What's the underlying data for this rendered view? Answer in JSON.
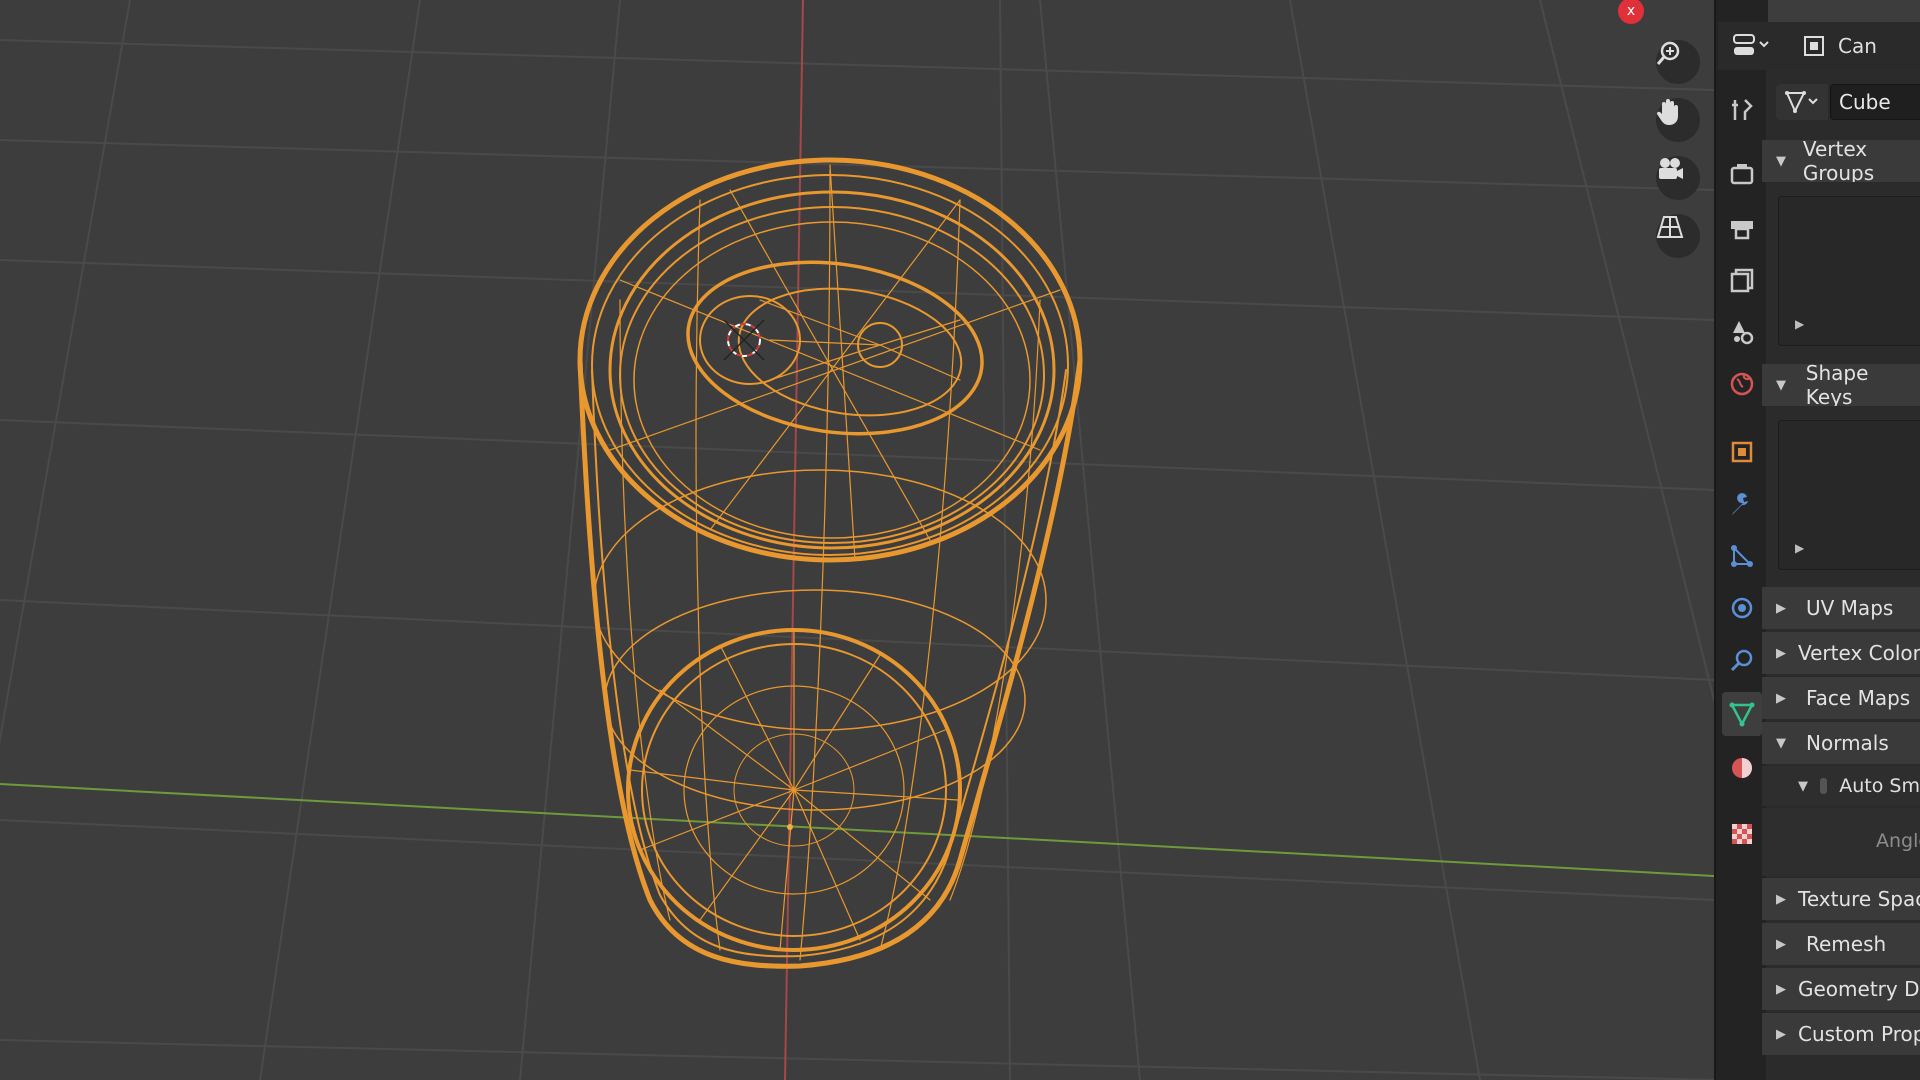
{
  "viewport": {
    "close_label": "x",
    "nav_icons": [
      "zoom-icon",
      "hand-pan-icon",
      "camera-icon",
      "perspective-grid-icon"
    ]
  },
  "properties_header": {
    "editor_icon": "editor-type-icon",
    "object_name": "Can"
  },
  "property_tabs": [
    {
      "name": "tool-icon",
      "color": "#c9c9c9"
    },
    {
      "name": "render-icon",
      "color": "#c9c9c9"
    },
    {
      "name": "output-icon",
      "color": "#c9c9c9"
    },
    {
      "name": "view-layer-icon",
      "color": "#c9c9c9"
    },
    {
      "name": "scene-icon",
      "color": "#c9c9c9"
    },
    {
      "name": "world-icon",
      "color": "#d55454"
    },
    {
      "name": "object-icon",
      "color": "#e08a3c"
    },
    {
      "name": "modifier-icon",
      "color": "#5b8fd6"
    },
    {
      "name": "particles-icon",
      "color": "#5b8fd6"
    },
    {
      "name": "physics-icon",
      "color": "#5b8fd6"
    },
    {
      "name": "constraints-icon",
      "color": "#5b8fd6"
    },
    {
      "name": "mesh-data-icon",
      "color": "#31c48d"
    },
    {
      "name": "material-icon",
      "color": "#d55454"
    },
    {
      "name": "texture-icon",
      "color": "#d55454"
    }
  ],
  "mesh": {
    "name": "Cube"
  },
  "sections": {
    "vertex_groups": "Vertex Groups",
    "shape_keys": "Shape Keys",
    "uv_maps": "UV Maps",
    "vertex_colors": "Vertex Colors",
    "face_maps": "Face Maps",
    "normals": "Normals",
    "auto_smooth": "Auto Sm",
    "angle": "Angle",
    "texture_space": "Texture Space",
    "remesh": "Remesh",
    "geometry_data": "Geometry Data",
    "custom_properties": "Custom Properties"
  },
  "colors": {
    "wire": "#e8982e",
    "x_axis": "#a54848",
    "y_axis": "#6e9a3c",
    "grid": "#4a4a4a",
    "active_tab": "#3e3e3e"
  }
}
